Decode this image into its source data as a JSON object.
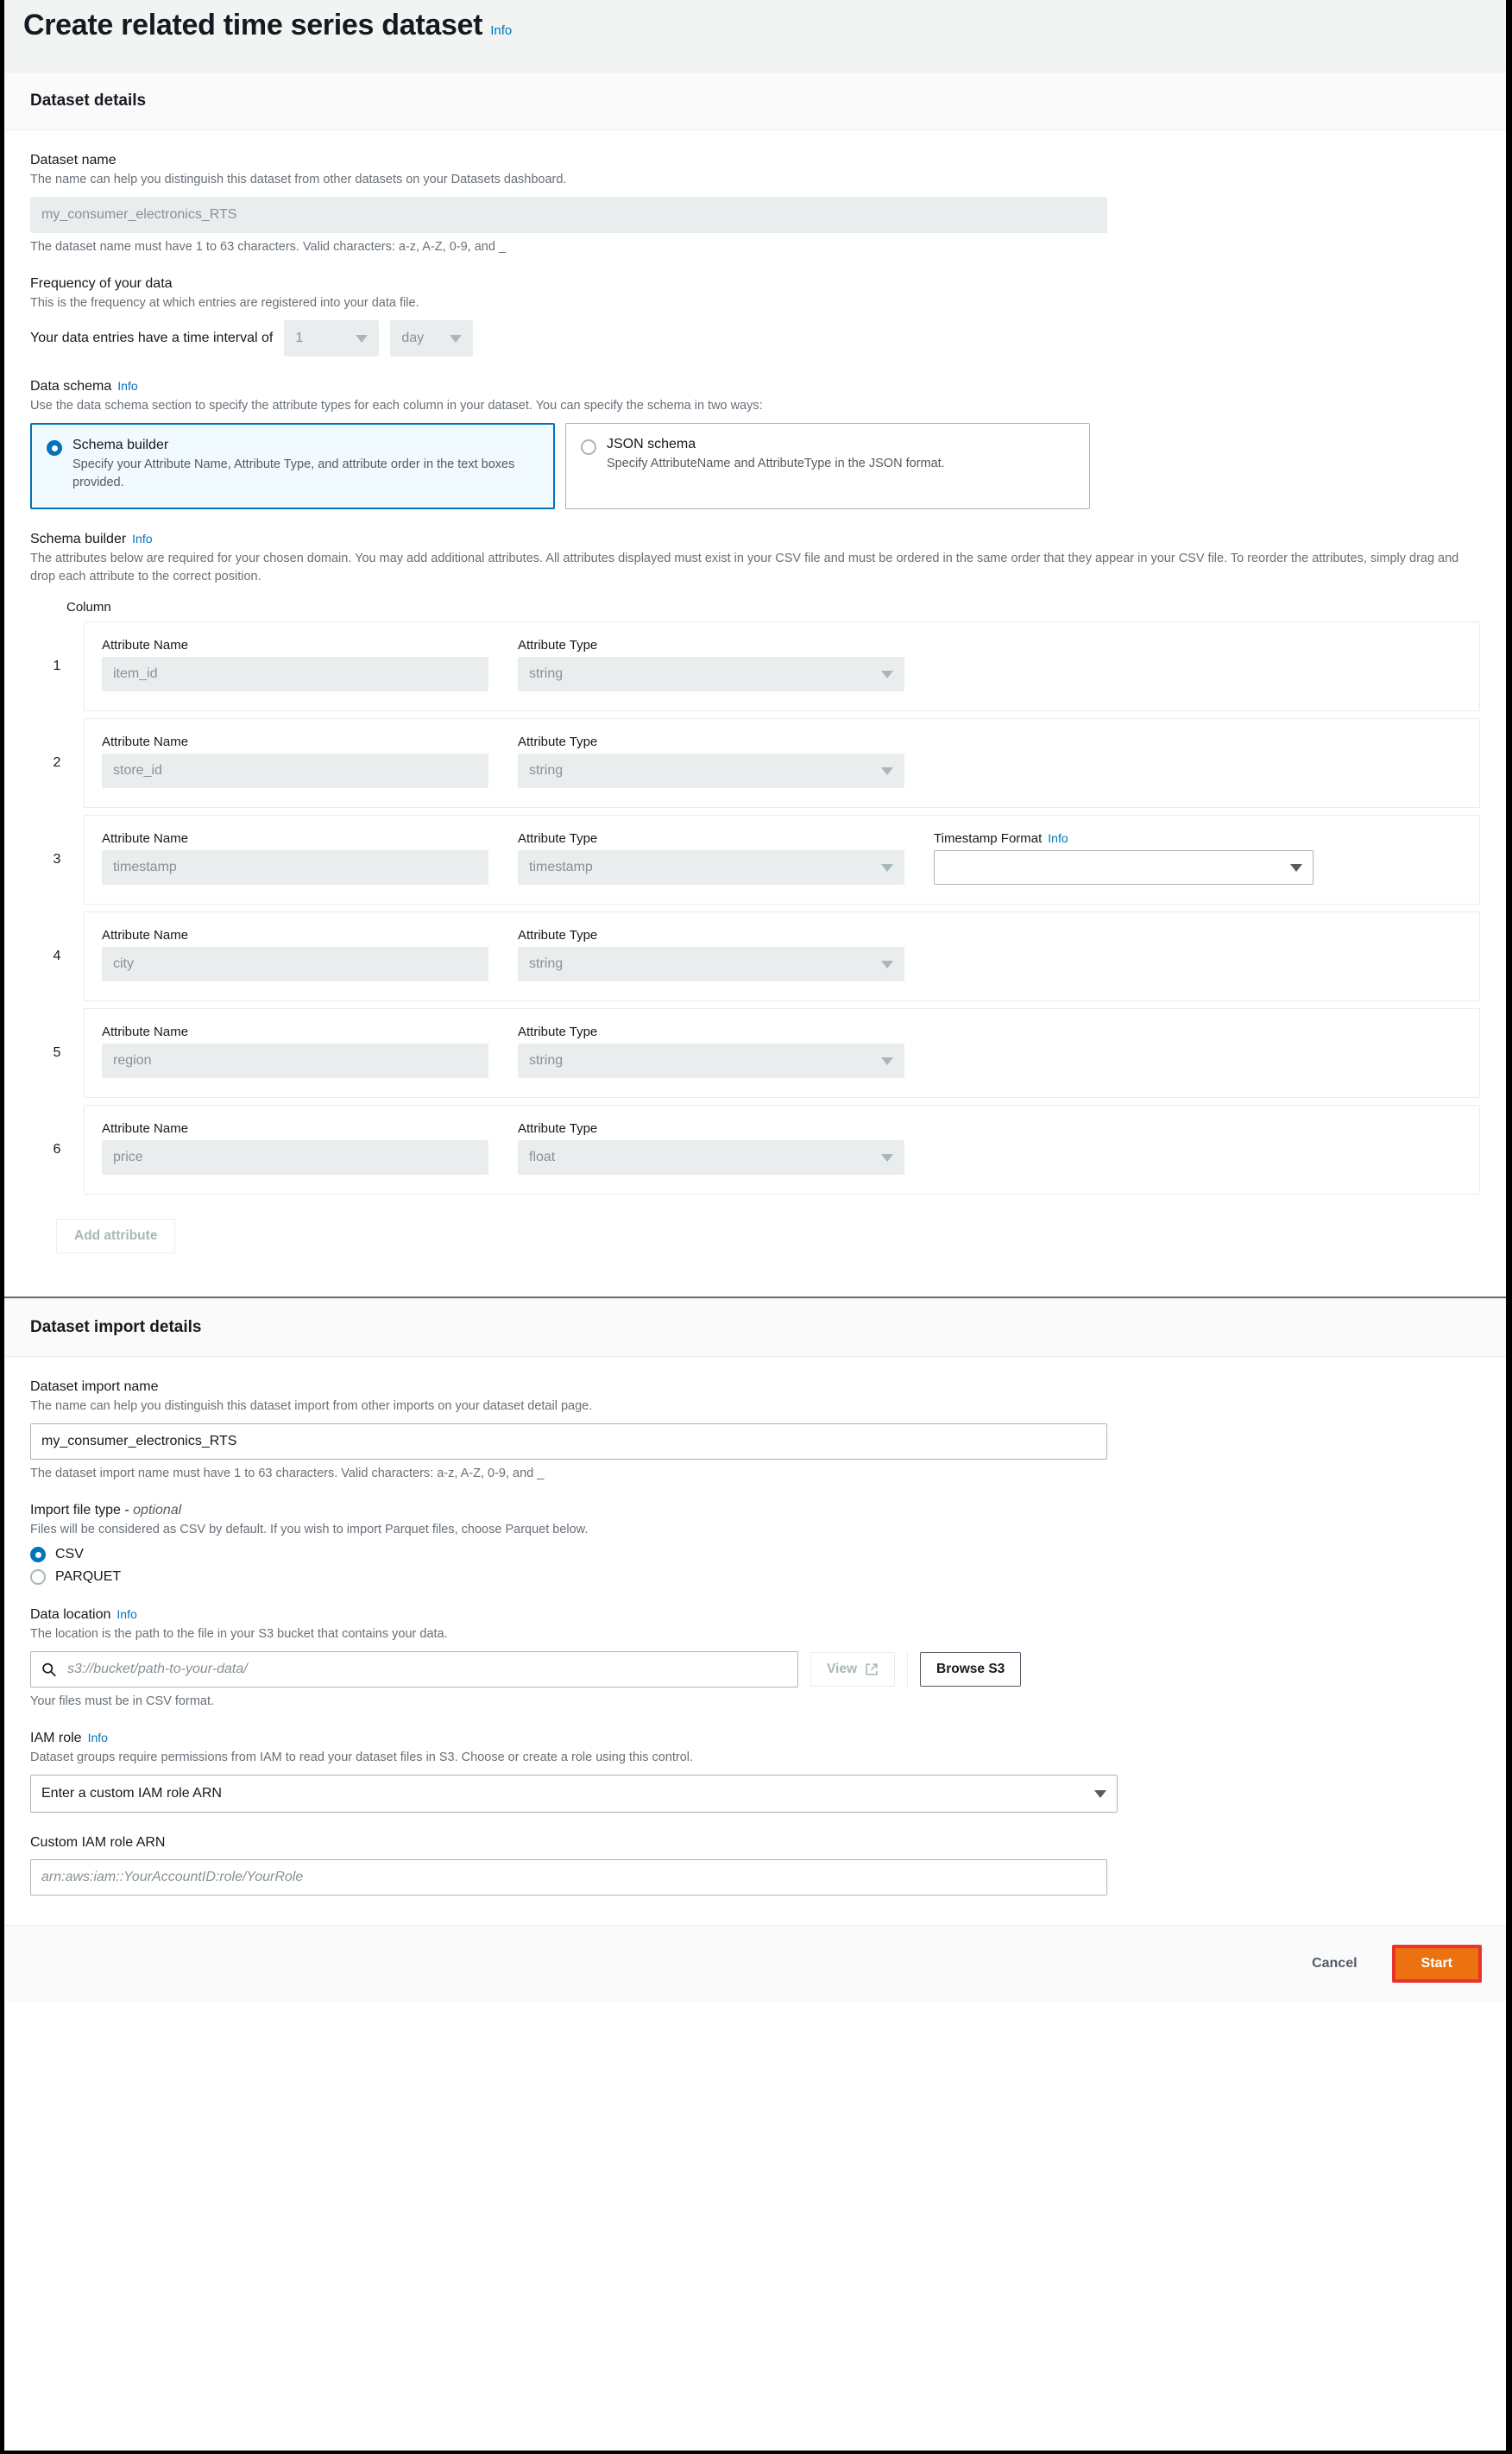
{
  "page": {
    "title": "Create related time series dataset",
    "info_label": "Info"
  },
  "dataset_details": {
    "section_title": "Dataset details",
    "dataset_name": {
      "label": "Dataset name",
      "description": "The name can help you distinguish this dataset from other datasets on your Datasets dashboard.",
      "value": "my_consumer_electronics_RTS",
      "hint": "The dataset name must have 1 to 63 characters. Valid characters: a-z, A-Z, 0-9, and _"
    },
    "frequency": {
      "label": "Frequency of your data",
      "description": "This is the frequency at which entries are registered into your data file.",
      "prefix_text": "Your data entries have a time interval of",
      "interval_value": "1",
      "unit_value": "day"
    },
    "data_schema": {
      "label": "Data schema",
      "info_label": "Info",
      "description": "Use the data schema section to specify the attribute types for each column in your dataset. You can specify the schema in two ways:",
      "options": [
        {
          "title": "Schema builder",
          "description": "Specify your Attribute Name, Attribute Type, and attribute order in the text boxes provided.",
          "selected": true
        },
        {
          "title": "JSON schema",
          "description": "Specify AttributeName and AttributeType in the JSON format.",
          "selected": false
        }
      ]
    },
    "schema_builder": {
      "label": "Schema builder",
      "info_label": "Info",
      "description": "The attributes below are required for your chosen domain. You may add additional attributes. All attributes displayed must exist in your CSV file and must be ordered in the same order that they appear in your CSV file. To reorder the attributes, simply drag and drop each attribute to the correct position.",
      "column_header": "Column",
      "attribute_name_label": "Attribute Name",
      "attribute_type_label": "Attribute Type",
      "timestamp_format_label": "Timestamp Format",
      "timestamp_format_info": "Info",
      "rows": [
        {
          "index": "1",
          "name": "item_id",
          "type": "string",
          "has_timestamp_format": false,
          "timestamp_format": ""
        },
        {
          "index": "2",
          "name": "store_id",
          "type": "string",
          "has_timestamp_format": false,
          "timestamp_format": ""
        },
        {
          "index": "3",
          "name": "timestamp",
          "type": "timestamp",
          "has_timestamp_format": true,
          "timestamp_format": ""
        },
        {
          "index": "4",
          "name": "city",
          "type": "string",
          "has_timestamp_format": false,
          "timestamp_format": ""
        },
        {
          "index": "5",
          "name": "region",
          "type": "string",
          "has_timestamp_format": false,
          "timestamp_format": ""
        },
        {
          "index": "6",
          "name": "price",
          "type": "float",
          "has_timestamp_format": false,
          "timestamp_format": ""
        }
      ],
      "add_attribute_label": "Add attribute"
    }
  },
  "import_details": {
    "section_title": "Dataset import details",
    "import_name": {
      "label": "Dataset import name",
      "description": "The name can help you distinguish this dataset import from other imports on your dataset detail page.",
      "value": "my_consumer_electronics_RTS",
      "hint": "The dataset import name must have 1 to 63 characters. Valid characters: a-z, A-Z, 0-9, and _"
    },
    "file_type": {
      "label": "Import file type - ",
      "label_optional": "optional",
      "description": "Files will be considered as CSV by default. If you wish to import Parquet files, choose Parquet below.",
      "options": [
        {
          "label": "CSV",
          "selected": true
        },
        {
          "label": "PARQUET",
          "selected": false
        }
      ]
    },
    "data_location": {
      "label": "Data location",
      "info_label": "Info",
      "description": "The location is the path to the file in your S3 bucket that contains your data.",
      "placeholder": "s3://bucket/path-to-your-data/",
      "value": "",
      "hint": "Your files must be in CSV format.",
      "view_label": "View",
      "browse_label": "Browse S3"
    },
    "iam_role": {
      "label": "IAM role",
      "info_label": "Info",
      "description": "Dataset groups require permissions from IAM to read your dataset files in S3. Choose or create a role using this control.",
      "selected": "Enter a custom IAM role ARN",
      "custom_label": "Custom IAM role ARN",
      "custom_placeholder": "arn:aws:iam::YourAccountID:role/YourRole",
      "custom_value": ""
    }
  },
  "footer": {
    "cancel_label": "Cancel",
    "start_label": "Start"
  }
}
